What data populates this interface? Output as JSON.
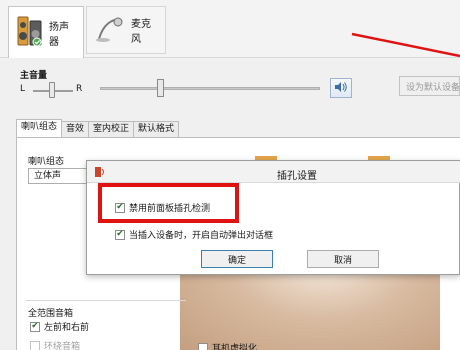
{
  "device_tabs": [
    {
      "label": "扬声器",
      "icon": "speaker-icon"
    },
    {
      "label": "麦克风",
      "icon": "microphone-icon"
    }
  ],
  "master_volume": {
    "label": "主音量",
    "left_label": "L",
    "right_label": "R",
    "balance_level": 0.45,
    "volume_level": 0.28
  },
  "default_device_button": "设为默认设备",
  "tabs": [
    "喇叭组态",
    "音效",
    "室内校正",
    "默认格式"
  ],
  "speaker_config": {
    "label": "喇叭组态",
    "selected": "立体声"
  },
  "full_range": {
    "label": "全范围音箱",
    "options": [
      {
        "label": "左前和右前",
        "checked": true
      },
      {
        "label": "环绕音箱",
        "checked": false
      }
    ]
  },
  "virtual_option_partial": "耳机虚拟化",
  "dialog": {
    "title": "插孔设置",
    "options": [
      {
        "label": "禁用前面板插孔检测",
        "checked": true
      },
      {
        "label": "当插入设备时，开启自动弹出对话框",
        "checked": true
      }
    ],
    "ok_label": "确定",
    "cancel_label": "取消"
  },
  "colors": {
    "highlight": "#e01313",
    "arrow": "#e01313"
  }
}
